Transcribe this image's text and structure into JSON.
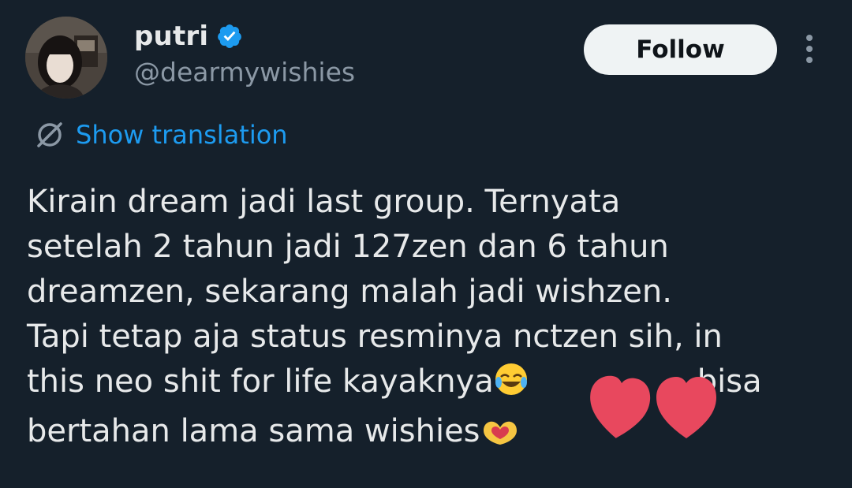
{
  "author": {
    "display_name": "putri",
    "handle": "@dearmywishies",
    "verified": true
  },
  "actions": {
    "follow_label": "Follow",
    "more_icon": "more-vertical-icon"
  },
  "translation": {
    "label": "Show translation",
    "icon": "translate-icon"
  },
  "tweet": {
    "lines": [
      "Kirain dream jadi last group. Ternyata",
      "setelah 2 tahun jadi 127zen dan 6 tahun",
      "dreamzen, sekarang malah jadi wishzen.",
      "Tapi tetap aja status resminya nctzen sih, in",
      "this neo shit for life kayaknya",
      "bisa",
      "bertahan lama sama wishies"
    ],
    "emojis": [
      "face-with-tears-of-joy",
      "heart-hands"
    ]
  },
  "colors": {
    "background": "#15202b",
    "text_primary": "#e7e9ea",
    "text_secondary": "#8b98a5",
    "accent": "#1d9bf0",
    "button_bg": "#eff3f4",
    "sticker_heart": "#e8485e"
  }
}
